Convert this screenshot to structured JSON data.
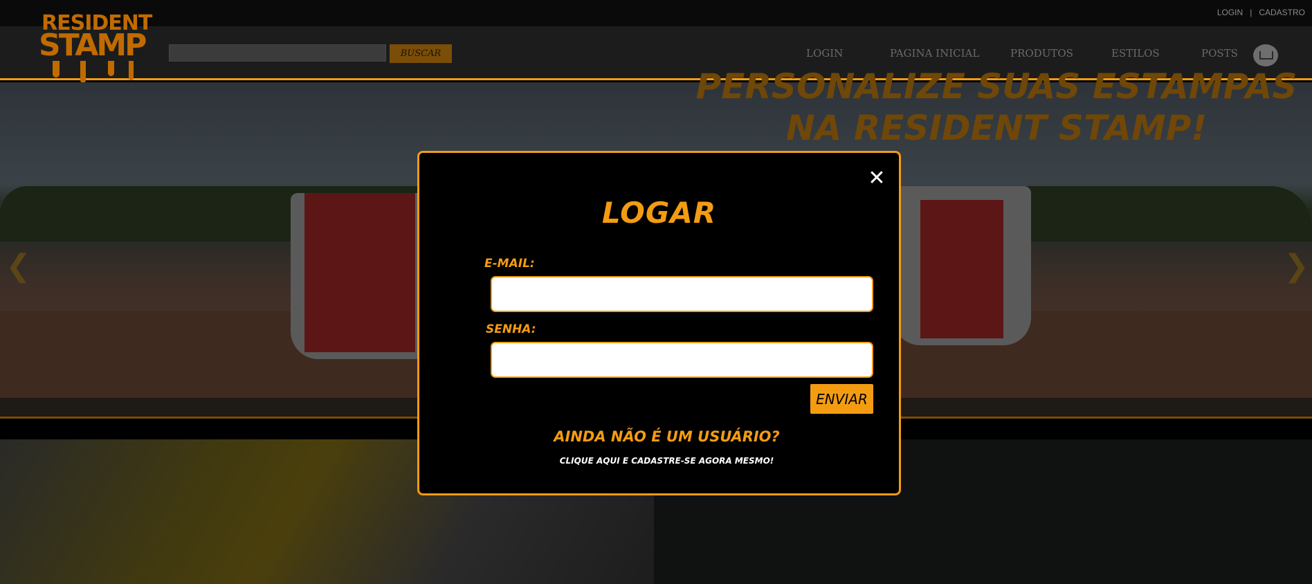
{
  "topbar": {
    "login": "LOGIN",
    "separator": "|",
    "register": "CADASTRO"
  },
  "brand": {
    "line1": "RESIDENT",
    "line2": "STAMP"
  },
  "search": {
    "placeholder": "",
    "button": "BUSCAR"
  },
  "nav": [
    {
      "label": "LOGIN"
    },
    {
      "label": "PAGINA INICIAL"
    },
    {
      "label": "PRODUTOS"
    },
    {
      "label": "ESTILOS"
    },
    {
      "label": "POSTS"
    }
  ],
  "cart": {
    "icon": "cart-icon"
  },
  "carousel": {
    "prev": "❮",
    "next": "❯"
  },
  "promo": {
    "text": "PERSONALIZE SUAS ESTAMPAS NA RESIDENT STAMP!"
  },
  "modal": {
    "title": "LOGAR",
    "close": "✕",
    "email_label": "E-MAIL:",
    "email_value": "",
    "password_label": "SENHA:",
    "password_value": "",
    "submit": "ENVIAR",
    "register_title": "AINDA NÃO É UM USUÁRIO?",
    "register_link": "CLIQUE AQUI E CADASTRE-SE AGORA MESMO!"
  },
  "colors": {
    "accent": "#f39c12",
    "background": "#000000"
  }
}
